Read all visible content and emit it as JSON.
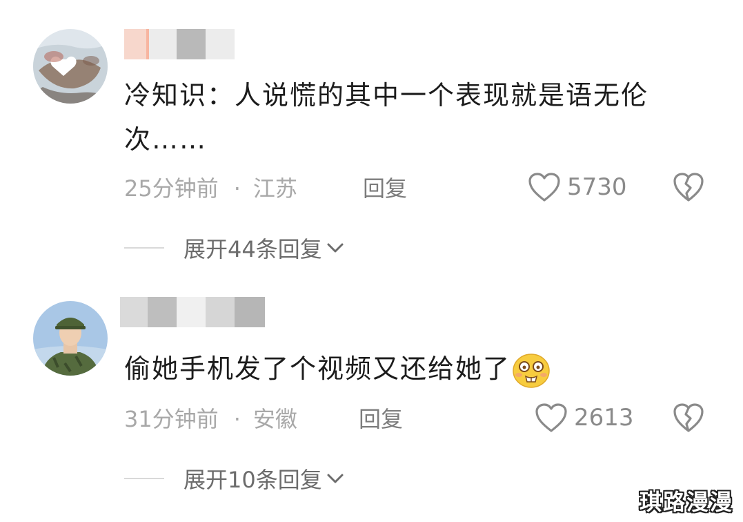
{
  "comments": [
    {
      "text": "冷知识：人说慌的其中一个表现就是语无伦次……",
      "time": "25分钟前",
      "location": "江苏",
      "reply_label": "回复",
      "likes": "5730",
      "expand_label": "展开44条回复"
    },
    {
      "text": "偷她手机发了个视频又还给她了",
      "time": "31分钟前",
      "location": "安徽",
      "reply_label": "回复",
      "likes": "2613",
      "expand_label": "展开10条回复"
    }
  ],
  "separator": "·",
  "watermark": "琪路漫漫",
  "icons": {
    "like": "heart-outline-icon",
    "dislike": "broken-heart-icon",
    "expand": "chevron-down-icon",
    "emoji": "grin-emoji-icon"
  }
}
